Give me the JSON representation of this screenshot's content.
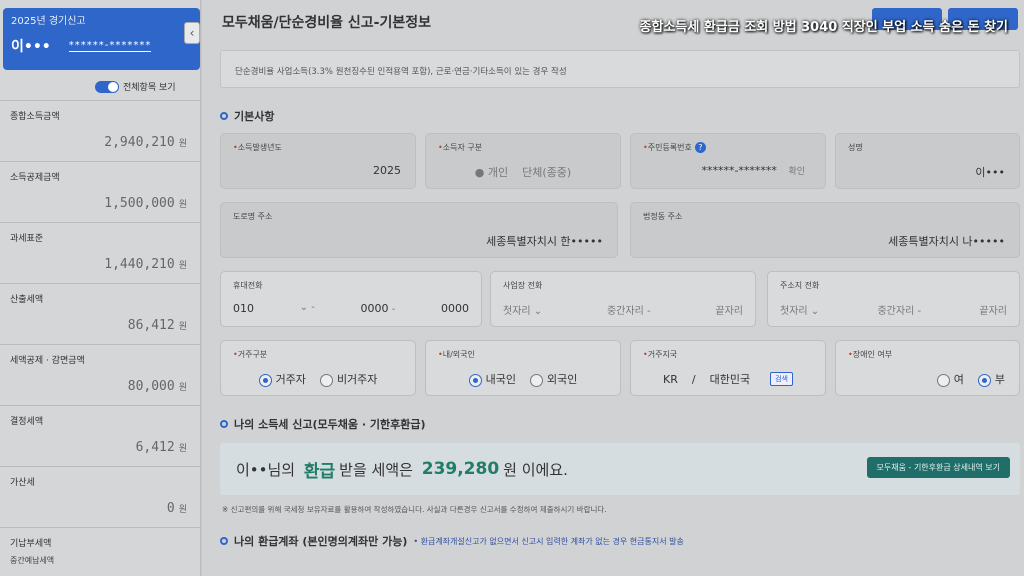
{
  "overlay_title": "종합소득세 환급금 조회 방법 3040 직장인 부업 소득 숨은 돈 찾기",
  "sidebar": {
    "header_title": "2025년 경기신고",
    "user_name": "이•••",
    "user_id": "******-*******",
    "collapse_icon": "‹",
    "toggle_label": "전체항목 보기",
    "items": [
      {
        "label": "종합소득금액",
        "value": "2,940,210",
        "unit": "원"
      },
      {
        "label": "소득공제금액",
        "value": "1,500,000",
        "unit": "원"
      },
      {
        "label": "과세표준",
        "value": "1,440,210",
        "unit": "원"
      },
      {
        "label": "산출세액",
        "value": "86,412",
        "unit": "원"
      },
      {
        "label": "세액공제 · 감면금액",
        "value": "80,000",
        "unit": "원"
      },
      {
        "label": "결정세액",
        "value": "6,412",
        "unit": "원"
      },
      {
        "label": "가산세",
        "value": "0",
        "unit": "원"
      },
      {
        "label": "기납부세액",
        "value": "",
        "unit": "",
        "sub": "중간예납세액"
      }
    ]
  },
  "main": {
    "page_title": "모두채움/단순경비율 신고-기본정보",
    "info_text": "단순경비율 사업소득(3.3% 원천징수된 인적용역 포함), 근로·연금·기타소득이 있는 경우 작성",
    "section_basic": "기본사항",
    "fields": {
      "year": {
        "label": "소득발생년도",
        "value": "2025"
      },
      "taxpayer_type": {
        "label": "소득자 구분",
        "opt1": "개인",
        "opt2": "단체(종중)"
      },
      "rrn": {
        "label": "주민등록번호",
        "value": "******-*******",
        "suffix": "확인"
      },
      "name": {
        "label": "성명",
        "value": "이•••"
      },
      "road_address": {
        "label": "도로명 주소",
        "value": "세종특별자치시 한•••••"
      },
      "lot_address": {
        "label": "법정동 주소",
        "value": "세종특별자치시 나•••••"
      },
      "mobile": {
        "label": "휴대전화",
        "p1": "010",
        "p2": "0000",
        "p3": "0000",
        "sep": "-"
      },
      "biz_phone": {
        "label": "사업장 전화",
        "p1": "첫자리",
        "p2": "중간자리",
        "p3": "끝자리"
      },
      "home_phone": {
        "label": "주소지 전화",
        "p1": "첫자리",
        "p2": "중간자리",
        "p3": "끝자리"
      },
      "residency": {
        "label": "거주구분",
        "opt1": "거주자",
        "opt2": "비거주자"
      },
      "nationality": {
        "label": "내/외국인",
        "opt1": "내국인",
        "opt2": "외국인"
      },
      "country": {
        "label": "거주지국",
        "code": "KR",
        "name": "대한민국",
        "btn": "검색"
      },
      "disability": {
        "label": "장애인 여부",
        "opt1": "여",
        "opt2": "부"
      }
    },
    "section_report": "나의 소득세 신고(모두채움 · 기한후환급)",
    "refund": {
      "prefix": "이••님의",
      "highlight": "환급",
      "mid": "받을 세액은",
      "amount": "239,280",
      "suffix": "원 이에요.",
      "button": "모두채움 - 기한후환급 상세내역 보기"
    },
    "footnote": "※ 신고편의를 위해 국세청 보유자료를 활용하여 작성하였습니다. 사실과 다른경우 신고서를 수정하여 제출하시기 바랍니다.",
    "section_account": "나의 환급계좌 (본인명의계좌만 가능)",
    "account_note": "• 환급계좌개설신고가 없으면서 신고시 입력한 계좌가 없는 경우 현금통지서 발송"
  }
}
